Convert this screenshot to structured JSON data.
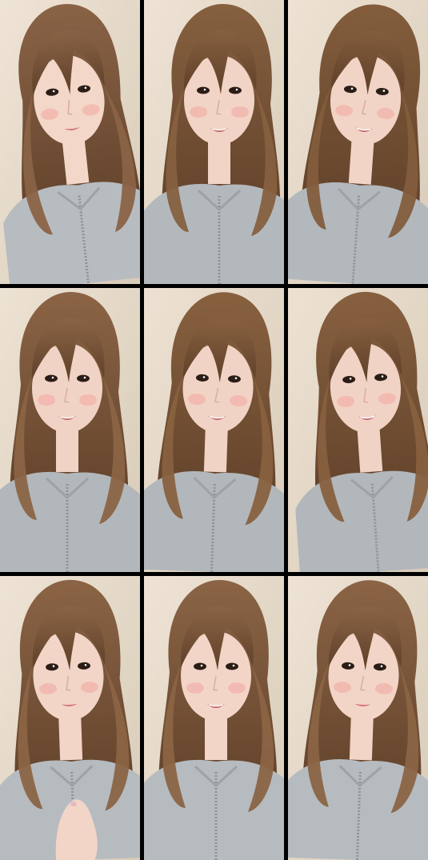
{
  "frames": [
    {
      "id": 1,
      "skin": "#f3d7c8",
      "hair": "#8a6346",
      "hoodie": "#b7bcc0",
      "wall": "#efe4d6"
    },
    {
      "id": 2,
      "skin": "#f2d4c6",
      "hair": "#86603f",
      "hoodie": "#b3b8bd",
      "wall": "#eee3d5"
    },
    {
      "id": 3,
      "skin": "#f2d4c6",
      "hair": "#835d3c",
      "hoodie": "#b3b8bd",
      "wall": "#eee2d4"
    },
    {
      "id": 4,
      "skin": "#f1d3c5",
      "hair": "#8b6445",
      "hoodie": "#b2b7bb",
      "wall": "#ede2d3"
    },
    {
      "id": 5,
      "skin": "#f1d3c5",
      "hair": "#88613f",
      "hoodie": "#b2b7bb",
      "wall": "#ede1d3"
    },
    {
      "id": 6,
      "skin": "#f1d3c5",
      "hair": "#87603f",
      "hoodie": "#b2b7bb",
      "wall": "#ede1d2"
    },
    {
      "id": 7,
      "skin": "#f2d5c7",
      "hair": "#8b6445",
      "hoodie": "#b6bbbf",
      "wall": "#eee3d5"
    },
    {
      "id": 8,
      "skin": "#f2d5c7",
      "hair": "#8b6445",
      "hoodie": "#b6bbbf",
      "wall": "#eee3d5"
    },
    {
      "id": 9,
      "skin": "#f2d5c7",
      "hair": "#8b6445",
      "hoodie": "#b6bbbf",
      "wall": "#eee3d5"
    }
  ]
}
